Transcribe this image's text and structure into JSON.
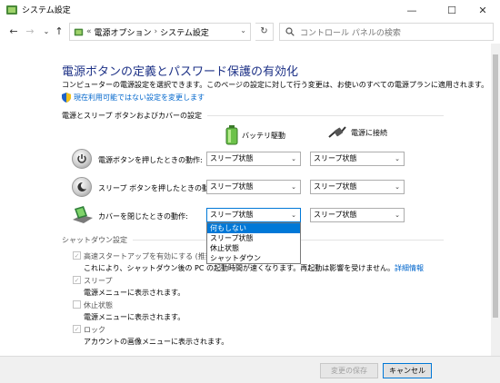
{
  "window": {
    "title": "システム設定",
    "minimize": "—",
    "maximize": "☐",
    "close": "✕"
  },
  "nav": {
    "back": "←",
    "forward": "→",
    "recent": "⌄",
    "up": "↑",
    "address_prefix": "«",
    "crumb1": "電源オプション",
    "crumb_sep": "›",
    "crumb2": "システム設定",
    "address_dropdown": "⌄",
    "refresh": "↻",
    "search_placeholder": "コントロール パネルの検索"
  },
  "page": {
    "heading": "電源ボタンの定義とパスワード保護の有効化",
    "description": "コンピューターの電源設定を選択できます。このページの設定に対して行う変更は、お使いのすべての電源プランに適用されます。",
    "unavailable_link": "現在利用可能ではない設定を変更します"
  },
  "power_section": {
    "title": "電源とスリープ ボタンおよびカバーの設定",
    "col_battery": "バッテリ駆動",
    "col_plugged": "電源に接続",
    "rows": [
      {
        "label": "電源ボタンを押したときの動作:",
        "battery": "スリープ状態",
        "plugged": "スリープ状態"
      },
      {
        "label": "スリープ ボタンを押したときの動作:",
        "battery": "スリープ状態",
        "plugged": "スリープ状態"
      },
      {
        "label": "カバーを閉じたときの動作:",
        "battery": "スリープ状態",
        "plugged": "スリープ状態"
      }
    ],
    "dropdown_options": [
      "何もしない",
      "スリープ状態",
      "休止状態",
      "シャットダウン"
    ]
  },
  "shutdown_section": {
    "title": "シャットダウン設定",
    "items": [
      {
        "label": "高速スタートアップを有効にする (推奨)",
        "sub": "これにより、シャットダウン後の PC の起動時間が速くなります。再起動は影響を受けません。",
        "link": "詳細情報",
        "checked": "✓"
      },
      {
        "label": "スリープ",
        "sub": "電源メニューに表示されます。",
        "checked": "✓"
      },
      {
        "label": "休止状態",
        "sub": "電源メニューに表示されます。",
        "checked": ""
      },
      {
        "label": "ロック",
        "sub": "アカウントの画像メニューに表示されます。",
        "checked": "✓"
      }
    ]
  },
  "footer": {
    "save": "変更の保存",
    "cancel": "キャンセル"
  },
  "colors": {
    "heading": "#1e3287",
    "link": "#0066cc",
    "accent": "#0078d7"
  }
}
